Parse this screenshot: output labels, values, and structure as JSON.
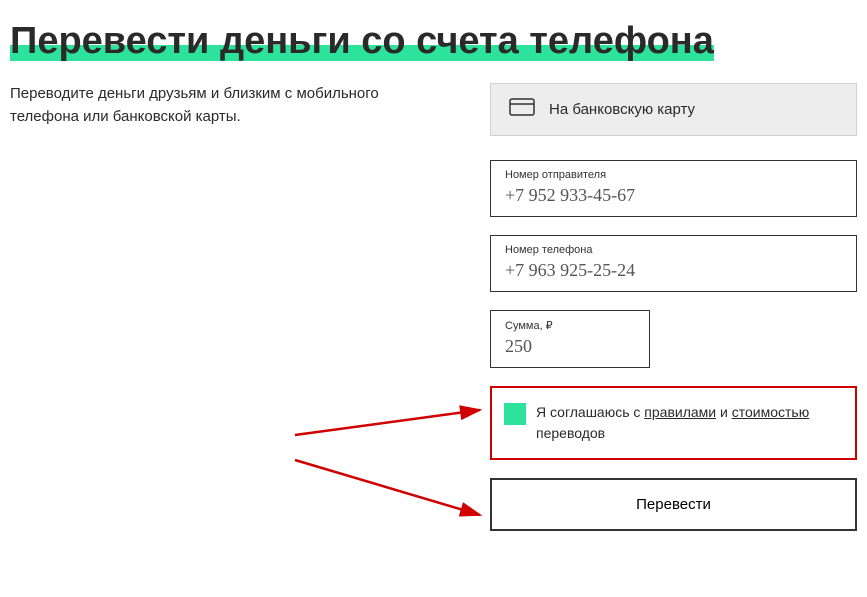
{
  "title": "Перевести деньги со счета телефона",
  "description": "Переводите деньги друзьям и близким с мобильного телефона или банковской карты.",
  "cardOption": {
    "label": "На банковскую карту"
  },
  "fields": {
    "sender": {
      "label": "Номер отправителя",
      "value": "+7 952 933-45-67"
    },
    "phone": {
      "label": "Номер телефона",
      "value": "+7 963 925-25-24"
    },
    "amount": {
      "label": "Сумма, ₽",
      "value": "250"
    }
  },
  "agree": {
    "prefix": "Я соглашаюсь с ",
    "link1": "правилами",
    "middle": " и ",
    "link2": "стоимостью",
    "suffix": " переводов"
  },
  "submit": "Перевести"
}
